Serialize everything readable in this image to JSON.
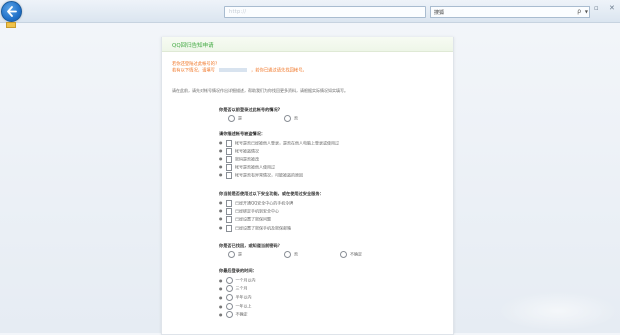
{
  "browser": {
    "address_text": "http://",
    "search_label": "搜狐",
    "search_btn": "ρ",
    "window_controls": "▫ ✕"
  },
  "page": {
    "title": "QQ回归告知申请",
    "notice_line1": "若你还登陆过此帐号的?",
    "notice_line2_left": "若有以下情况，请填写",
    "notice_line2_right": "，若你已通过请先找回帐号。",
    "intro": "请在此前，请先对帐号情况作出详细描述，帮助我们为你找回更多资料，请根据实际情况如实填写。"
  },
  "questions": [
    {
      "label": "你是否以前登录过此帐号的情况?",
      "type": "radio",
      "options": [
        "是",
        "否"
      ]
    },
    {
      "label": "请你描述帐号被盗情况：",
      "type": "checkbox",
      "options": [
        "帐号是否已经被他人登录，是否在他人电脑上登录或使用过",
        "帐号被盗情况",
        "密码是否被改",
        "帐号是否被他人使用过",
        "帐号是否有异常情况，可能被盗的原因"
      ]
    },
    {
      "label": "你当前是否使用过以下安全功能，或在使用过安全服务：",
      "type": "checkbox",
      "options": [
        "已经开通QQ安全中心的手机令牌",
        "已经绑定手机到安全中心",
        "已经设置了密保问题",
        "已经设置了密保手机及密保邮箱"
      ]
    },
    {
      "label": "你是否已找回，或知道当前密码？",
      "type": "radio",
      "options": [
        "是",
        "否",
        "不确定"
      ]
    },
    {
      "label": "你最后登录的时间：",
      "type": "radio",
      "options": [
        "一个月以内",
        "三个月",
        "半年以内",
        "一年以上",
        "不确定"
      ]
    }
  ]
}
